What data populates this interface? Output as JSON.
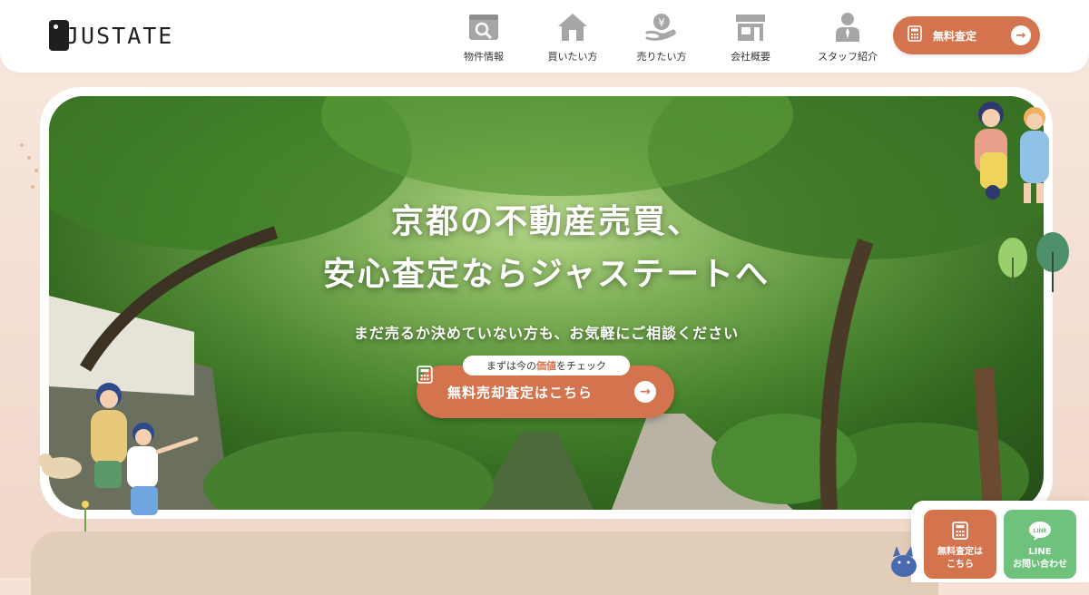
{
  "header": {
    "logo_text": "JUSTATE",
    "nav": [
      {
        "label": "物件情報",
        "icon": "property-search-icon"
      },
      {
        "label": "買いたい方",
        "icon": "house-icon"
      },
      {
        "label": "売りたい方",
        "icon": "yen-hand-icon"
      },
      {
        "label": "会社概要",
        "icon": "shop-icon"
      },
      {
        "label": "スタッフ紹介",
        "icon": "staff-icon"
      }
    ],
    "cta_label": "無料査定"
  },
  "hero": {
    "title_line1": "京都の不動産売買、",
    "title_line2": "安心査定ならジャステートへ",
    "subtitle": "まだ売るか決めていない方も、お気軽にご相談ください",
    "tag_before": "まずは今の",
    "tag_highlight": "価値",
    "tag_after": "をチェック",
    "cta_label": "無料売却査定はこちら"
  },
  "floating": {
    "assess_line1": "無料査定は",
    "assess_line2": "こちら",
    "line_line1": "LINE",
    "line_line2": "お問い合わせ"
  },
  "colors": {
    "accent": "#d4744f",
    "line_green": "#6fc27b",
    "background": "#f6e3d6"
  }
}
